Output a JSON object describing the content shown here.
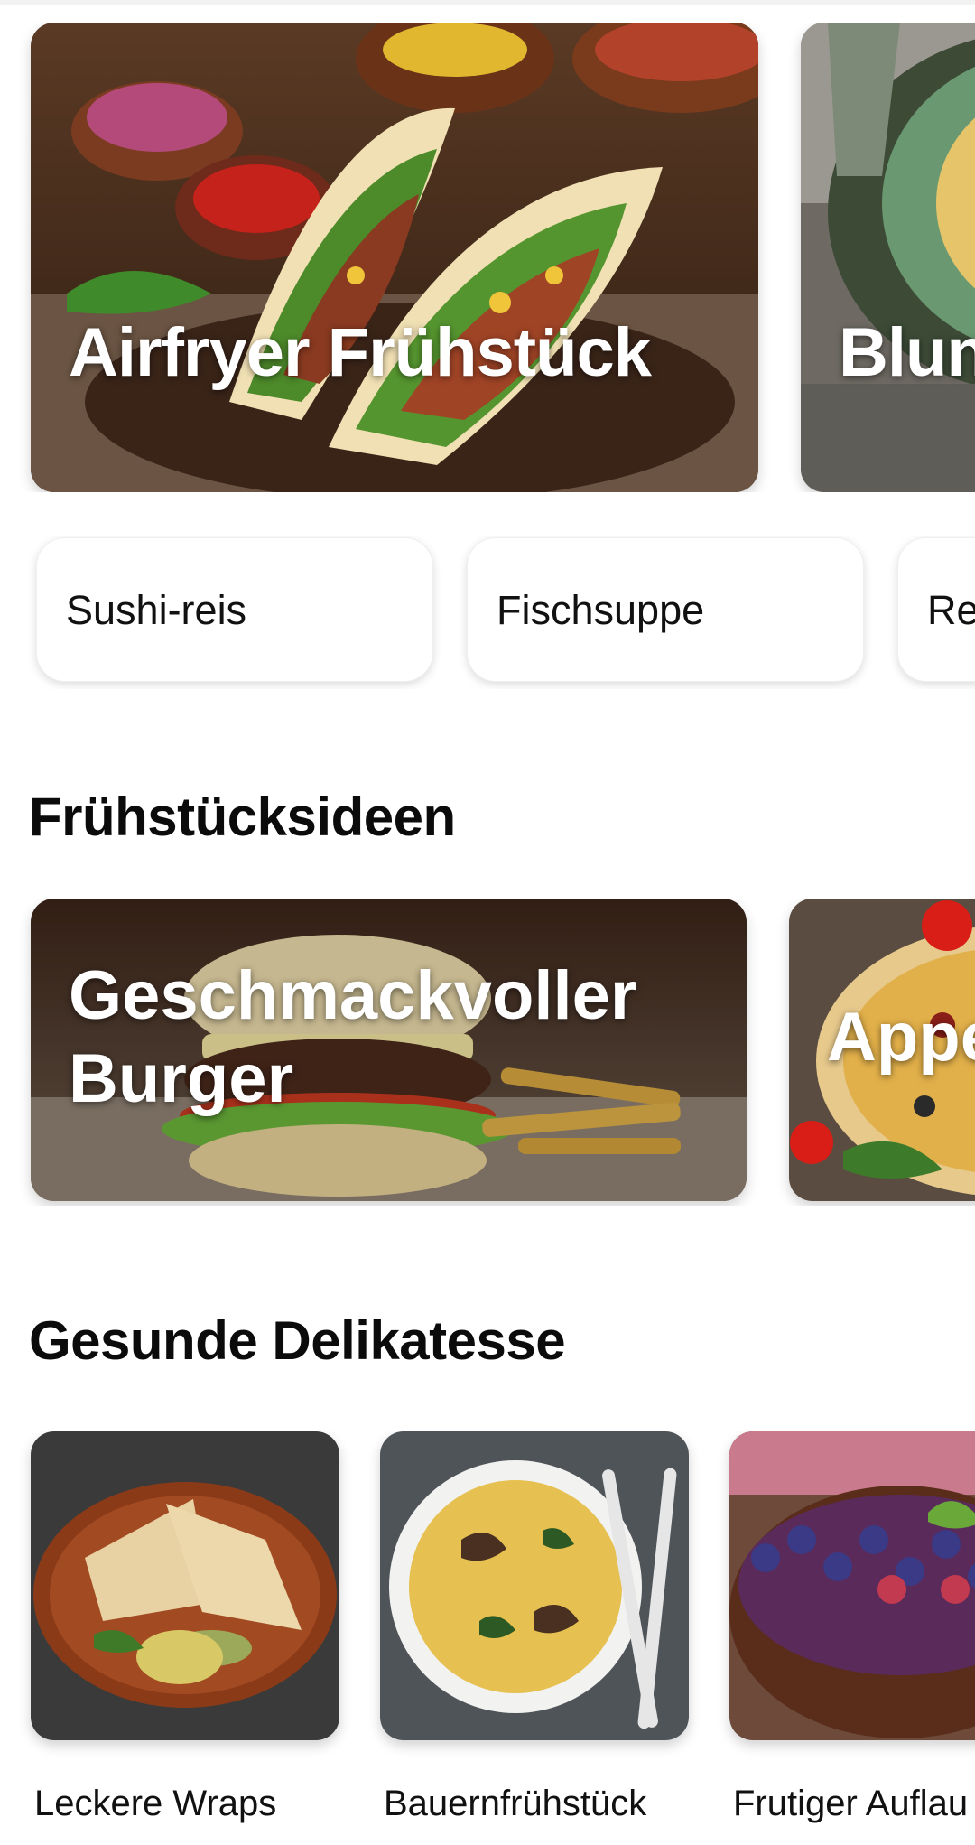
{
  "featured": {
    "cards": [
      {
        "title": "Airfryer Frühstück",
        "image": "tacos-photo"
      },
      {
        "title": "Blun",
        "image": "soup-photo"
      }
    ]
  },
  "chips": [
    "Sushi-reis",
    "Fischsuppe",
    "Re"
  ],
  "sections": {
    "breakfast": {
      "title": "Frühstücksideen",
      "cards": [
        {
          "title": "Geschmackvoller Burger",
          "image": "burger-photo"
        },
        {
          "title": "Appe",
          "image": "pizza-photo"
        }
      ]
    },
    "healthy": {
      "title": "Gesunde Delikatesse",
      "cards": [
        {
          "label": "Leckere Wraps",
          "image": "wraps-photo"
        },
        {
          "label": "Bauernfrühstück",
          "image": "omelette-photo"
        },
        {
          "label": "Frutiger Auflau",
          "image": "berry-cake-photo"
        }
      ]
    }
  },
  "colors": {
    "background": "#ffffff",
    "text": "#0a0a0a",
    "overlay_text": "#ffffff"
  }
}
